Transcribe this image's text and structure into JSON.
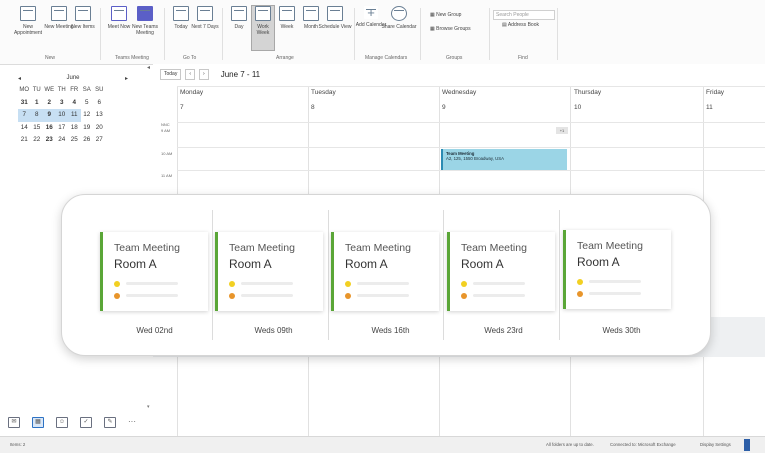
{
  "ribbon": {
    "buttons": [
      {
        "label": "New Appointment",
        "icon": "new-appointment-icon"
      },
      {
        "label": "New Meeting",
        "icon": "new-meeting-icon"
      },
      {
        "label": "New Items",
        "icon": "new-items-icon"
      },
      {
        "label": "Meet Now",
        "icon": "meet-now-icon"
      },
      {
        "label": "New Teams Meeting",
        "icon": "teams-icon"
      },
      {
        "label": "Today",
        "icon": "today-icon"
      },
      {
        "label": "Next 7 Days",
        "icon": "next7-icon"
      },
      {
        "label": "Day",
        "icon": "day-view-icon"
      },
      {
        "label": "Work Week",
        "icon": "work-week-icon"
      },
      {
        "label": "Week",
        "icon": "week-view-icon"
      },
      {
        "label": "Month",
        "icon": "month-view-icon"
      },
      {
        "label": "Schedule View",
        "icon": "schedule-view-icon"
      },
      {
        "label": "Add Calendar",
        "icon": "add-calendar-icon"
      },
      {
        "label": "Share Calendar",
        "icon": "share-calendar-icon"
      }
    ],
    "groups": [
      "New",
      "Teams Meeting",
      "Go To",
      "Arrange",
      "Manage Calendars",
      "Groups",
      "Find"
    ],
    "new_group": "New Group",
    "browse_groups": "Browse Groups",
    "search_people_placeholder": "Search People",
    "address_book": "Address Book"
  },
  "minical": {
    "month": "June",
    "prev": "◂",
    "next": "▸",
    "weekdays": [
      "MO",
      "TU",
      "WE",
      "TH",
      "FR",
      "SA",
      "SU"
    ],
    "weeks": [
      [
        "31",
        "1",
        "2",
        "3",
        "4",
        "5",
        "6"
      ],
      [
        "7",
        "8",
        "9",
        "10",
        "11",
        "12",
        "13"
      ],
      [
        "14",
        "15",
        "16",
        "17",
        "18",
        "19",
        "20"
      ],
      [
        "21",
        "22",
        "23",
        "24",
        "25",
        "26",
        "27"
      ]
    ]
  },
  "calendar": {
    "today_btn": "Today",
    "prev_btn": "‹",
    "next_btn": "›",
    "date_range": "June 7 - 11",
    "days": [
      {
        "name": "Monday",
        "num": "7"
      },
      {
        "name": "Tuesday",
        "num": "8"
      },
      {
        "name": "Wednesday",
        "num": "9"
      },
      {
        "name": "Thursday",
        "num": "10"
      },
      {
        "name": "Friday",
        "num": "11"
      }
    ],
    "timezone": "NNC",
    "times": [
      "9 AM",
      "10 AM",
      "11 AM"
    ],
    "more_badge": "+1",
    "event": {
      "title": "Team Meeting",
      "location": "A2, 125, 1550 Broadway, USA"
    }
  },
  "status": {
    "items": "Items: 2",
    "folders": "All folders are up to date.",
    "connection": "Connected to: Microsoft Exchange",
    "display": "Display Settings"
  },
  "overlay": {
    "cards": [
      {
        "title": "Team Meeting",
        "room": "Room A",
        "date": "Wed 02nd"
      },
      {
        "title": "Team Meeting",
        "room": "Room A",
        "date": "Weds 09th"
      },
      {
        "title": "Team Meeting",
        "room": "Room A",
        "date": "Weds 16th"
      },
      {
        "title": "Team Meeting",
        "room": "Room A",
        "date": "Weds 23rd"
      },
      {
        "title": "Team Meeting",
        "room": "Room A",
        "date": "Weds 30th"
      }
    ],
    "accent": "#5aa637",
    "dot_colors": [
      "#f2d022",
      "#e8952b"
    ]
  }
}
